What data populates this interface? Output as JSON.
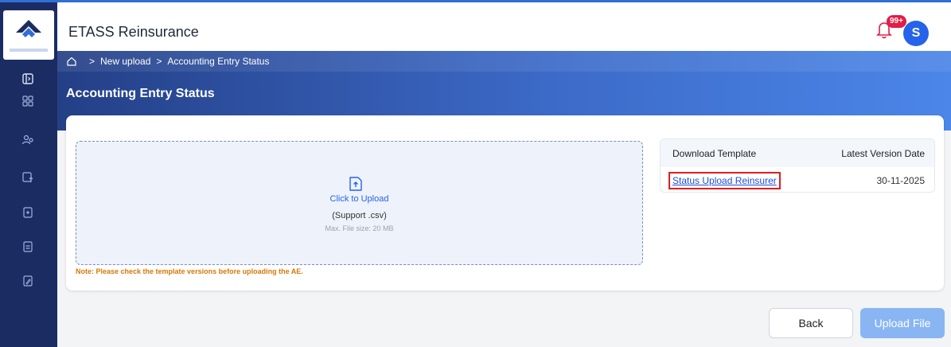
{
  "app": {
    "title": "ETASS Reinsurance"
  },
  "header": {
    "notification_badge": "99+",
    "avatar_initial": "S"
  },
  "breadcrumb": {
    "items": [
      "New upload",
      "Accounting Entry Status"
    ]
  },
  "page": {
    "title": "Accounting Entry Status"
  },
  "upload": {
    "click_label": "Click to Upload",
    "support_text": "(Support .csv)",
    "max_size_text": "Max. File size: 20 MB",
    "note": "Note: Please check the template versions before uploading the AE."
  },
  "template_table": {
    "headers": [
      "Download Template",
      "Latest Version Date"
    ],
    "rows": [
      {
        "name": "Status Upload Reinsurer",
        "date": "30-11-2025"
      }
    ]
  },
  "buttons": {
    "back": "Back",
    "upload_file": "Upload File"
  },
  "sidebar": {
    "icons": [
      "sidebar-toggle-icon",
      "dashboard-grid-icon",
      "users-icon",
      "upload-entry-icon",
      "add-document-icon",
      "document-icon",
      "edit-document-icon"
    ]
  },
  "colors": {
    "sidebar": "#1b2c63",
    "accent": "#2563eb",
    "note": "#d97706",
    "badge": "#e11d48"
  }
}
